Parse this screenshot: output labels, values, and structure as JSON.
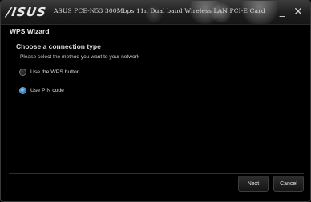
{
  "titlebar": {
    "brand": "/ISUS",
    "app_title": "ASUS PCE-N53 300Mbps 11n Dual band Wireless LAN PCI-E Card",
    "minimize_glyph": "_",
    "close_glyph": "✕",
    "minimize_icon": "minimize-icon",
    "close_icon": "close-icon"
  },
  "wizard": {
    "title": "WPS Wizard",
    "section_title": "Choose a connection type",
    "instruction": "Please select the method you want to your network",
    "options": [
      {
        "label": "Use the WPS button",
        "selected": false
      },
      {
        "label": "Use PIN code",
        "selected": true
      }
    ]
  },
  "buttons": {
    "next": "Next",
    "cancel": "Cancel"
  },
  "colors": {
    "background": "#000000",
    "selected_radio": "#3b84c2",
    "text": "#dcdcdc"
  }
}
